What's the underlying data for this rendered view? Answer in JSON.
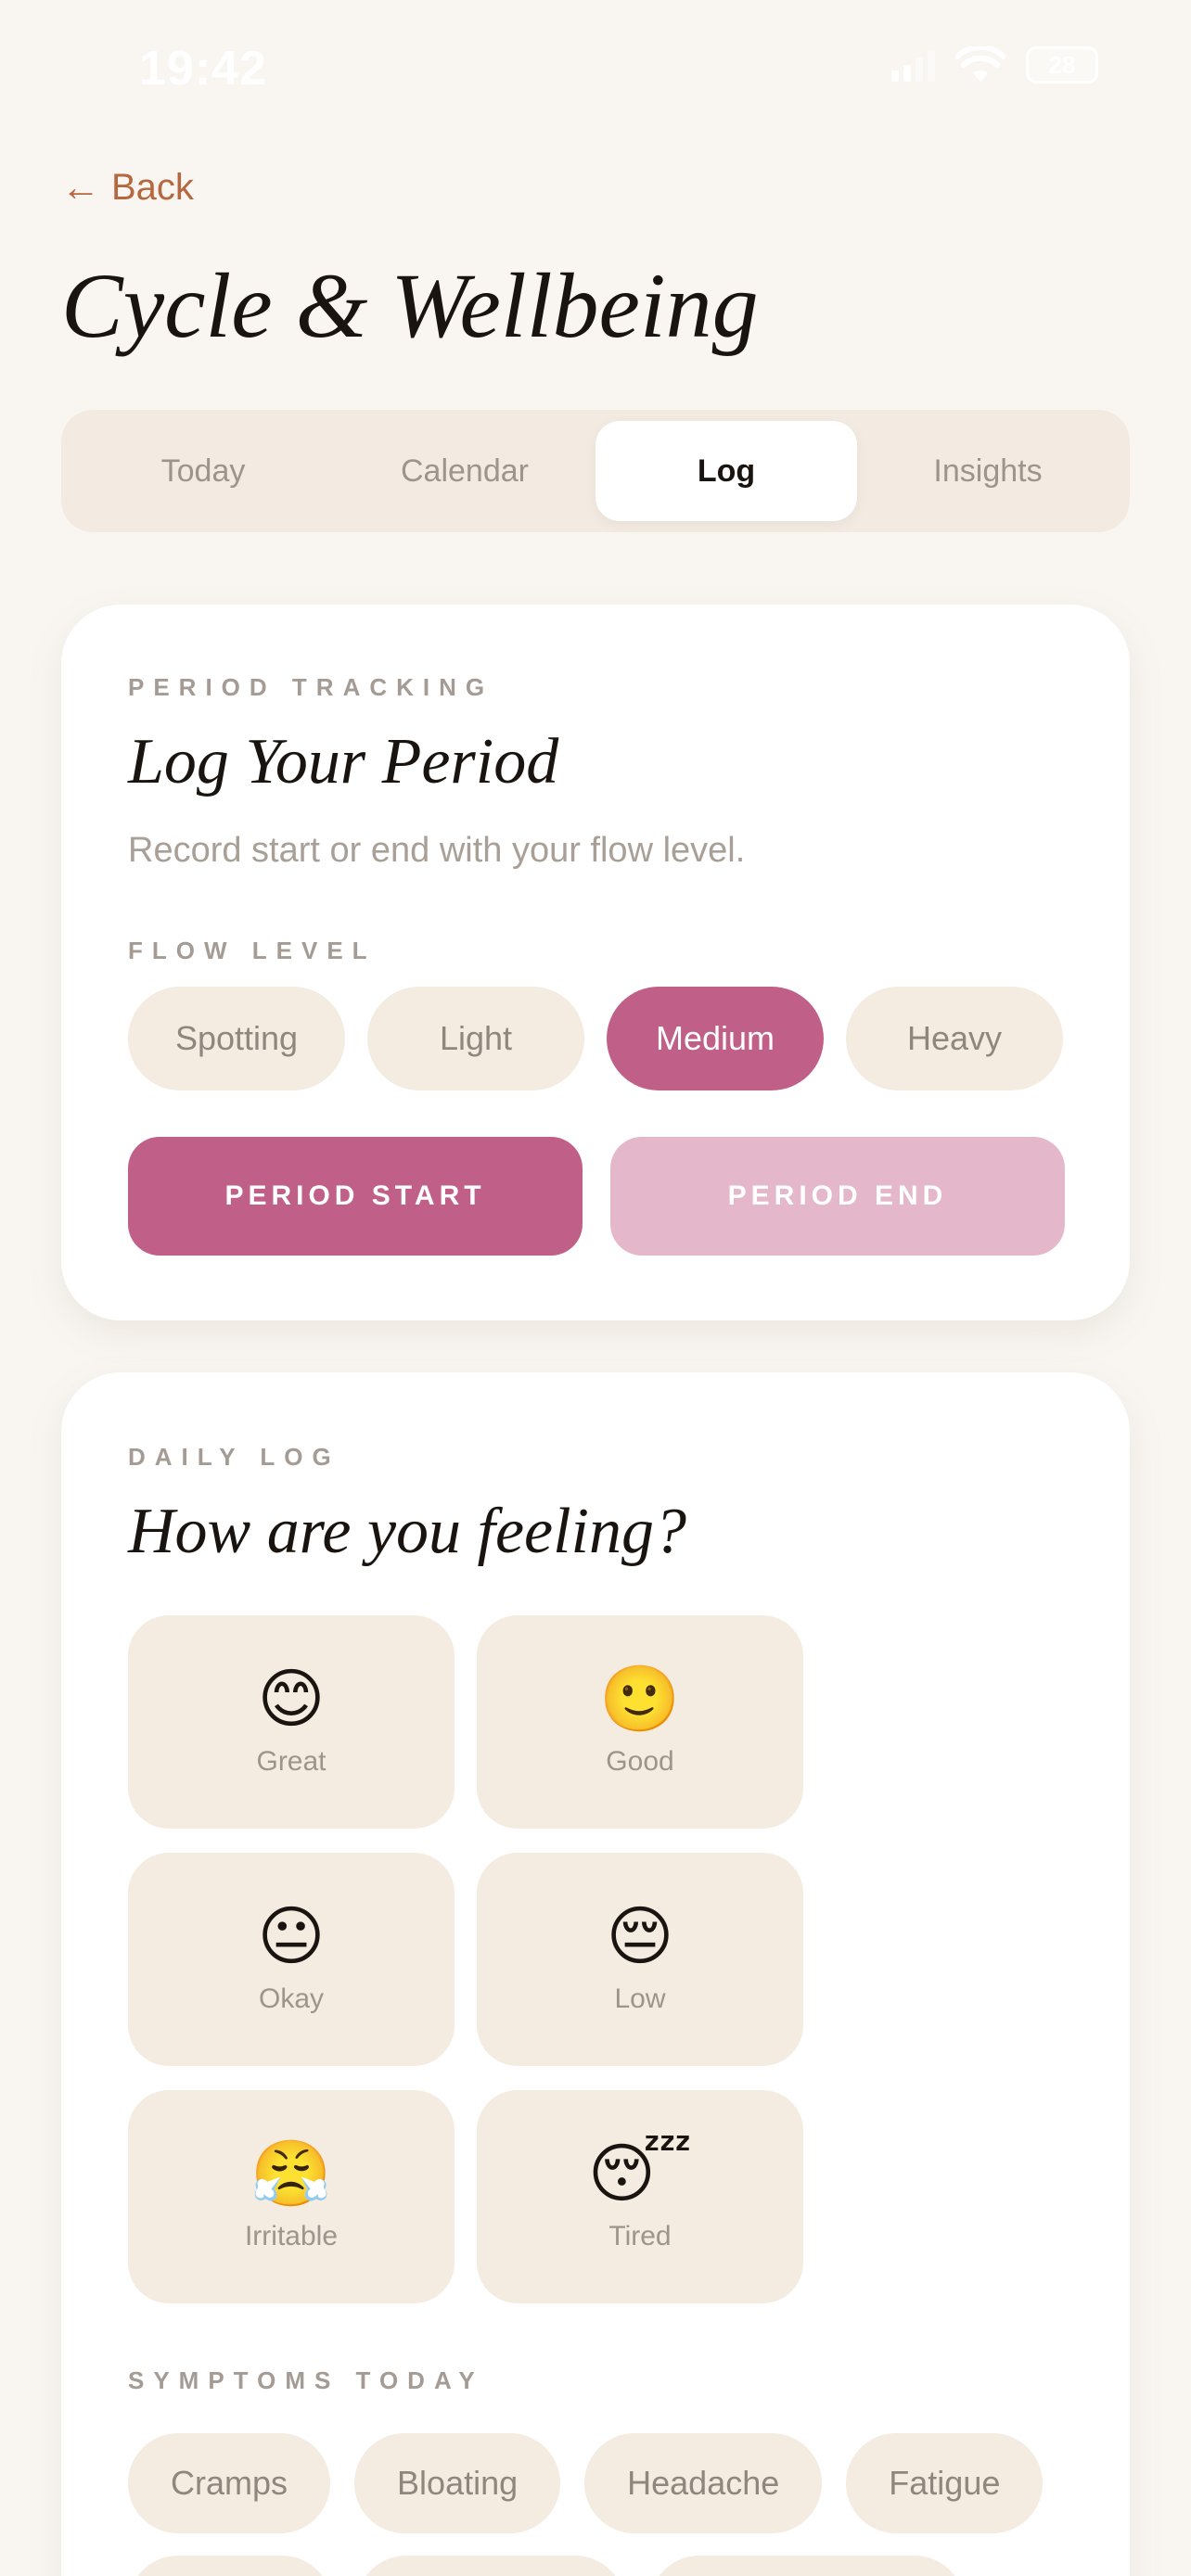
{
  "status": {
    "time": "19:42",
    "battery": "28",
    "icons": [
      "signal-icon",
      "wifi-icon",
      "battery-icon"
    ]
  },
  "nav": {
    "back_label": "Back",
    "back_icon": "arrow-left-icon"
  },
  "page": {
    "title": "Cycle & Wellbeing"
  },
  "tabs": [
    {
      "label": "Today"
    },
    {
      "label": "Calendar"
    },
    {
      "label": "Log",
      "active": true
    },
    {
      "label": "Insights"
    }
  ],
  "period_card": {
    "eyebrow": "PERIOD TRACKING",
    "heading": "Log Your Period",
    "subtitle": "Record start or end with your flow level.",
    "flow_label": "FLOW LEVEL",
    "flow_options": [
      "Spotting",
      "Light",
      "Medium",
      "Heavy"
    ],
    "selected_flow": "Medium",
    "start_label": "PERIOD START",
    "end_label": "PERIOD END"
  },
  "daily_card": {
    "eyebrow": "DAILY LOG",
    "heading": "How are you feeling?",
    "moods": [
      {
        "emoji": "😊",
        "label": "Great"
      },
      {
        "emoji": "🙂",
        "label": "Good"
      },
      {
        "emoji": "😐",
        "label": "Okay"
      },
      {
        "emoji": "😔",
        "label": "Low"
      },
      {
        "emoji": "😤",
        "label": "Irritable"
      },
      {
        "emoji": "😴",
        "label": "Tired"
      }
    ],
    "symptoms_label": "SYMPTOMS TODAY",
    "symptoms": [
      "Cramps",
      "Bloating",
      "Headache",
      "Fatigue"
    ]
  },
  "colors": {
    "background": "#f9f6f2",
    "accent": "#c05f88",
    "accent_light": "#e4b7ca",
    "chip": "#f4ebe1",
    "link": "#b5683f"
  }
}
